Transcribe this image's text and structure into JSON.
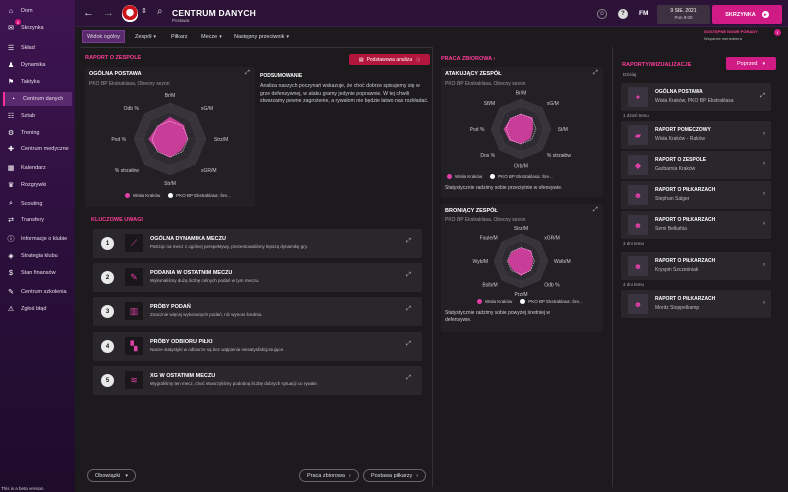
{
  "sidebar": {
    "items": [
      {
        "label": "Dom",
        "icon": "home-icon"
      },
      {
        "label": "Skrzynka",
        "icon": "inbox-icon",
        "badge": "2"
      },
      {
        "label": "Skład",
        "icon": "squad-icon"
      },
      {
        "label": "Dynamika",
        "icon": "dynamics-icon"
      },
      {
        "label": "Taktyka",
        "icon": "tactics-icon"
      },
      {
        "label": "Centrum danych",
        "icon": "data-hub-icon",
        "active": true
      },
      {
        "label": "Sztab",
        "icon": "staff-icon"
      },
      {
        "label": "Trening",
        "icon": "training-icon"
      },
      {
        "label": "Centrum medyczne",
        "icon": "medical-icon"
      },
      {
        "label": "Kalendarz",
        "icon": "calendar-icon"
      },
      {
        "label": "Rozgrywki",
        "icon": "competitions-icon"
      },
      {
        "label": "Scouting",
        "icon": "scouting-icon"
      },
      {
        "label": "Transfery",
        "icon": "transfers-icon"
      },
      {
        "label": "Informacje o klubie",
        "icon": "club-info-icon"
      },
      {
        "label": "Strategia klubu",
        "icon": "club-strategy-icon"
      },
      {
        "label": "Stan finansów",
        "icon": "finances-icon"
      },
      {
        "label": "Centrum szkolenia",
        "icon": "academy-icon"
      },
      {
        "label": "Zgłoś błąd",
        "icon": "report-bug-icon"
      }
    ],
    "beta_text": "This is a beta version"
  },
  "header": {
    "title": "CENTRUM DANYCH",
    "subtitle": "Postawa",
    "team_initials": "FM",
    "date": "9 SIE. 2021",
    "time": "Pon 9:00",
    "continue_label": "SKRZYNKA",
    "tip_title": "DOSTĘPNE NOWE PORADY",
    "tip_sub": "Wsparcie menedżera",
    "tip_count": "1"
  },
  "tabs": [
    {
      "label": "Widok ogólny",
      "active": true
    },
    {
      "label": "Zespół",
      "dropdown": true
    },
    {
      "label": "Piłkarz",
      "dropdown": false
    },
    {
      "label": "Mecze",
      "dropdown": true
    },
    {
      "label": "Następny przeciwnik",
      "dropdown": true
    }
  ],
  "left": {
    "section_title": "RAPORT O ZESPOLE",
    "button_label": "Podstawowa analiza",
    "card_title": "OGÓLNA POSTAWA",
    "card_sub": "PKO BP Ekstraklasa, Obecny sezon",
    "summary_title": "PODSUMOWANIE",
    "summary_text": "Analiza naszych poczynań wskazuje, że choć dobrze spisujemy się w grze defensywnej, w ataku gramy jedynie poprawnie. W tej chwili stwarzamy pewne zagrożenie, a rywalom nie będzie łatwo nas rozkładać.",
    "legend": [
      "Wisła Kraków",
      "PKO BP Ekstraklasa: Śre..."
    ],
    "key_title": "KLUCZOWE UWAGI",
    "insights": [
      {
        "n": "1",
        "title": "OGÓLNA DYNAMIKA MECZU",
        "desc": "Patrząc na mecz z ogólnej perspektywy, prezentowaliśmy lepszą dynamikę gry."
      },
      {
        "n": "2",
        "title": "PODANIA W OSTATNIM MECZU",
        "desc": "Wykonaliśmy dużą liczbę celnych podań w tym meczu."
      },
      {
        "n": "3",
        "title": "PRÓBY PODAŃ",
        "desc": "Znacznie więcej wykonanych podań, niż wynosi średnia."
      },
      {
        "n": "4",
        "title": "PRÓBY ODBIORU PIŁKI",
        "desc": "Nasze statystyki w odbiorze są bez wątpienia niesatysfakcjonujące."
      },
      {
        "n": "5",
        "title": "XG W OSTATNIM MECZU",
        "desc": "Wygraliśmy ten mecz, choć stworzyliśmy podobną liczbę dobrych sytuacji co rywale."
      }
    ],
    "view_label": "Obowiązki"
  },
  "middle": {
    "section_title": "PRACA ZBIOROWA",
    "attack_title": "ATAKUJĄCY ZESPÓŁ",
    "attack_sub": "PKO BP Ekstraklasa, Obecny sezon",
    "attack_note": "Statystycznie radzimy sobie przeciętnie w ofensywie.",
    "defend_title": "BRONIĄCY ZESPÓŁ",
    "defend_sub": "PKO BP Ekstraklasa, Obecny sezon",
    "defend_note": "Statystycznie radzimy sobie powyżej średniej w defensywie.",
    "legend": [
      "Wisła Kraków",
      "PKO BP Ekstraklasa: Śre..."
    ],
    "btn_team": "Praca zbiorowa",
    "btn_players": "Postawa piłkarzy"
  },
  "right": {
    "section_title": "RAPORTY/WIZUALIZACJE",
    "dropdown_label": "Poprzed",
    "groups": [
      {
        "label": "Dzisiaj",
        "items": [
          {
            "title": "OGÓLNA POSTAWA",
            "sub": "Wisła Kraków, PKO BP Ekstraklasa",
            "icon": "radar-report-icon"
          }
        ]
      },
      {
        "label": "1 dzień temu",
        "items": [
          {
            "title": "RAPORT POMECZOWY",
            "sub": "Wisła Kraków - Raków",
            "icon": "match-report-icon"
          },
          {
            "title": "RAPORT O ZESPOLE",
            "sub": "Garbarnia Kraków",
            "icon": "team-report-icon"
          },
          {
            "title": "RAPORT O PIŁKARZACH",
            "sub": "Stephan Salger",
            "icon": "player-avatar-icon"
          },
          {
            "title": "RAPORT O PIŁKARZACH",
            "sub": "Semi Belkahia",
            "icon": "player-avatar-icon"
          }
        ]
      },
      {
        "label": "3 dni temu",
        "items": [
          {
            "title": "RAPORT O PIŁKARZACH",
            "sub": "Kryspin Szcześniak",
            "icon": "player-avatar-icon"
          }
        ]
      },
      {
        "label": "4 dni temu",
        "items": [
          {
            "title": "RAPORT O PIŁKARZACH",
            "sub": "Moritz Stoppelkamp",
            "icon": "player-avatar-icon"
          }
        ]
      }
    ]
  },
  "radars": {
    "overall": {
      "axes": [
        "Br/M",
        "xG/M",
        "Strz/M",
        "xGR/M",
        "Str/M",
        "% strzałów",
        "Pod %",
        "Odb %"
      ],
      "team": [
        0.62,
        0.55,
        0.5,
        0.45,
        0.52,
        0.48,
        0.6,
        0.5
      ],
      "league": [
        0.5,
        0.5,
        0.5,
        0.5,
        0.5,
        0.5,
        0.5,
        0.5
      ]
    },
    "attack": {
      "axes": [
        "Br/M",
        "xG/M",
        "St/M",
        "% strzałów",
        "Orb/M",
        "Dos %",
        "Pod %",
        "Sfl/M"
      ],
      "team": [
        0.5,
        0.55,
        0.4,
        0.45,
        0.5,
        0.55,
        0.58,
        0.5
      ],
      "league": [
        0.5,
        0.5,
        0.5,
        0.5,
        0.5,
        0.5,
        0.5,
        0.5
      ]
    },
    "defend": {
      "axes": [
        "Strz/M",
        "xGR/M",
        "Wslb/M",
        "Odb %",
        "Prz/M",
        "Bslb/M",
        "Wyb/M",
        "Faule/M"
      ],
      "team": [
        0.5,
        0.55,
        0.45,
        0.5,
        0.55,
        0.45,
        0.5,
        0.48
      ],
      "league": [
        0.5,
        0.5,
        0.5,
        0.5,
        0.5,
        0.5,
        0.5,
        0.5
      ]
    }
  },
  "colors": {
    "accent": "#d01b85",
    "team_series": "#e040a8",
    "league_series": "#ffffff",
    "danger": "#b2163d"
  }
}
